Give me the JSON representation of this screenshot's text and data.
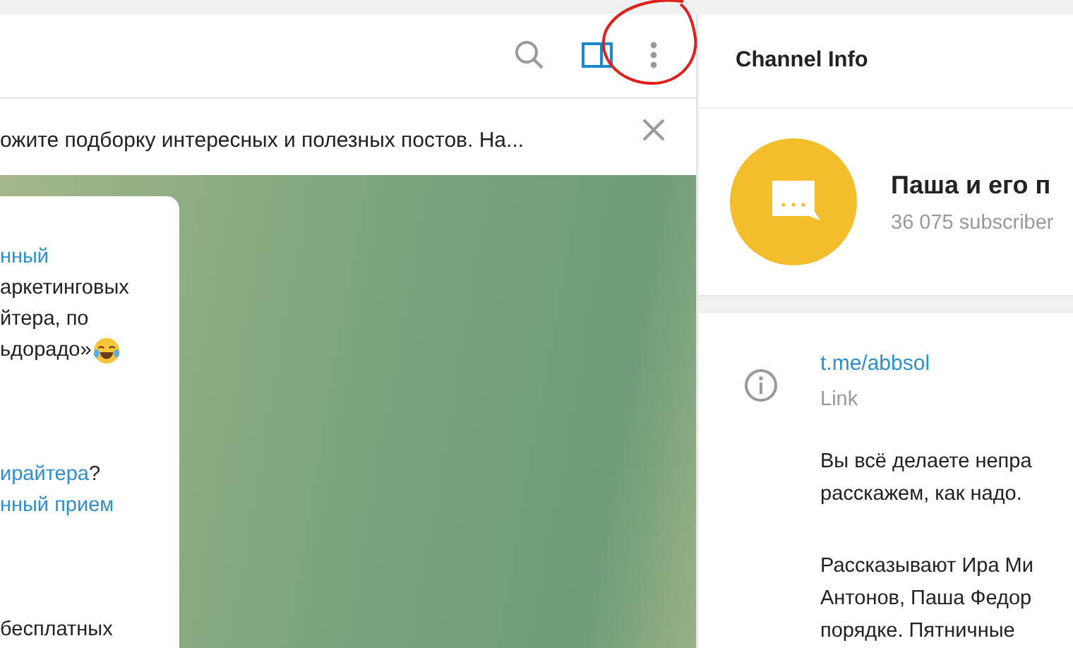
{
  "pinned_message": {
    "text": "ожите подборку интересных и полезных постов. На..."
  },
  "message": {
    "paragraphs": [
      [
        [
          {
            "text": "нный",
            "link": true
          }
        ],
        [
          {
            "text": "аркетинговых",
            "link": false
          }
        ],
        [
          {
            "text": "йтера, по",
            "link": false
          }
        ],
        [
          {
            "text": "ьдорадо»",
            "link": false
          }
        ]
      ],
      [
        [
          {
            "text": "ирайтера",
            "link": true
          },
          {
            "text": "?",
            "link": false
          }
        ],
        [
          {
            "text": "нный прием",
            "link": true
          }
        ]
      ],
      [
        [
          {
            "text": "бесплатных",
            "link": false
          }
        ]
      ]
    ]
  },
  "channel_info": {
    "title": "Channel Info",
    "name": "Паша и его п",
    "subscribers": "36 075 subscriber",
    "link": "t.me/abbsol",
    "link_label": "Link",
    "description": [
      [
        "Вы всё делаете непра",
        "расскажем, как надо."
      ],
      [
        "Рассказывают Ира Ми",
        "Антонов, Паша Федор",
        "порядке. Пятничные"
      ]
    ]
  }
}
